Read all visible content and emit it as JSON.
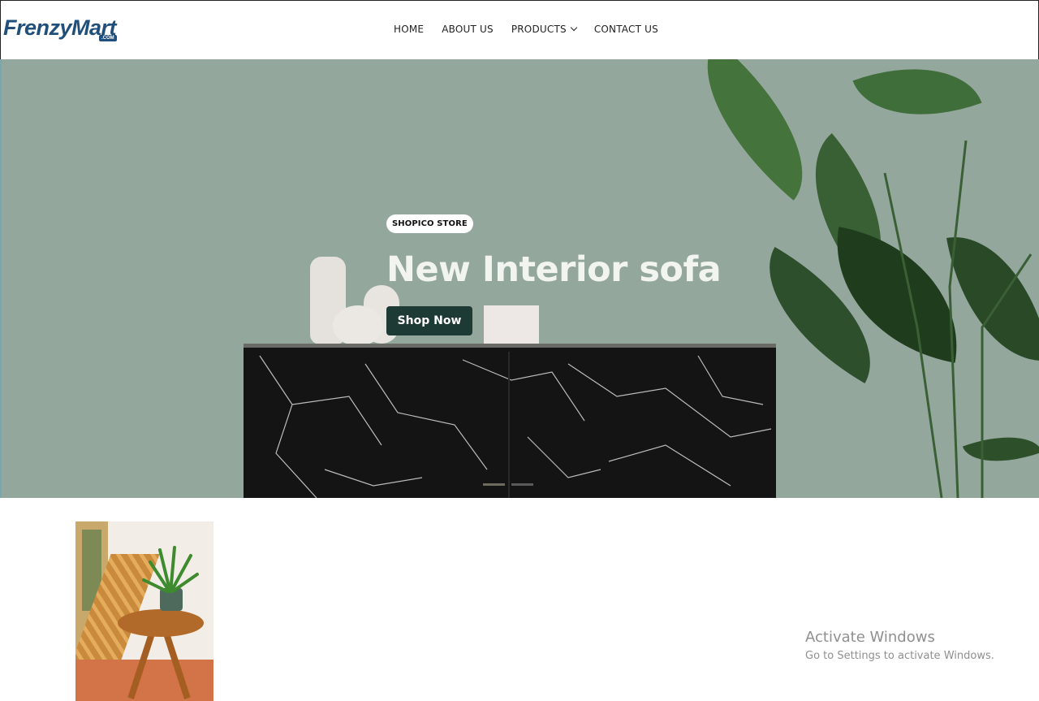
{
  "header": {
    "logo_text": "FrenzyMart",
    "logo_sub": ".COM",
    "nav": [
      {
        "label": "HOME"
      },
      {
        "label": "ABOUT US"
      },
      {
        "label": "PRODUCTS",
        "has_dropdown": true
      },
      {
        "label": "CONTACT US"
      }
    ]
  },
  "hero": {
    "badge": "SHOPICO STORE",
    "title": "New Interior sofa",
    "cta_label": "Shop Now",
    "slides_total": 2,
    "active_slide": 1
  },
  "colors": {
    "logo": "#1f4f7a",
    "hero_bg": "#93a79d",
    "cta_bg": "#1d3a34"
  },
  "watermark": {
    "title": "Activate Windows",
    "subtitle": "Go to Settings to activate Windows."
  }
}
